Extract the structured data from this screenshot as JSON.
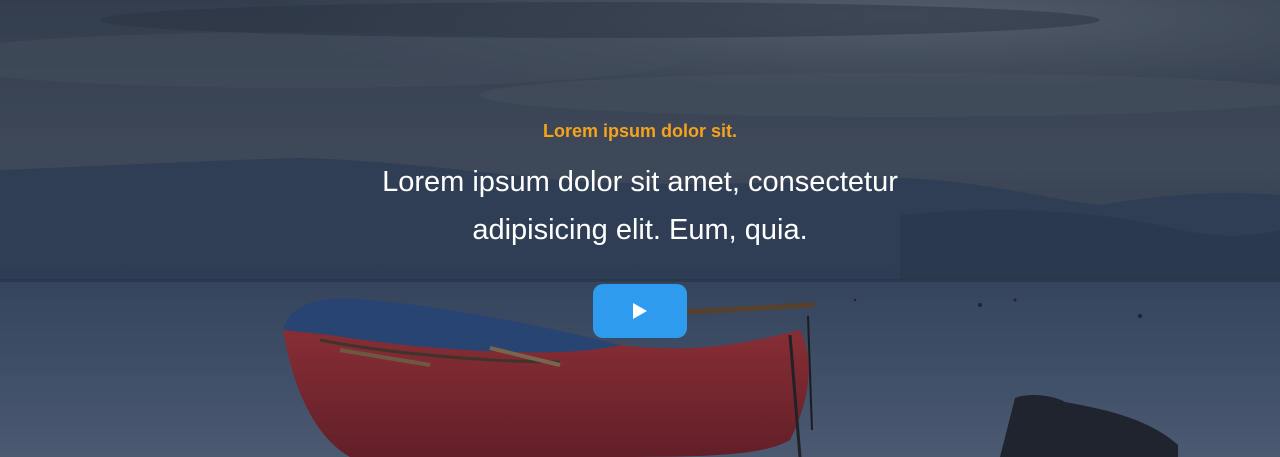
{
  "hero": {
    "eyebrow": "Lorem ipsum dolor sit.",
    "headline_line1": "Lorem ipsum dolor sit amet, consectetur",
    "headline_line2": "adipisicing elit. Eum, quia.",
    "play_button": {
      "icon": "play-icon",
      "color": "#2f9bef"
    },
    "colors": {
      "eyebrow": "#f6a31c",
      "headline": "#ffffff"
    }
  }
}
